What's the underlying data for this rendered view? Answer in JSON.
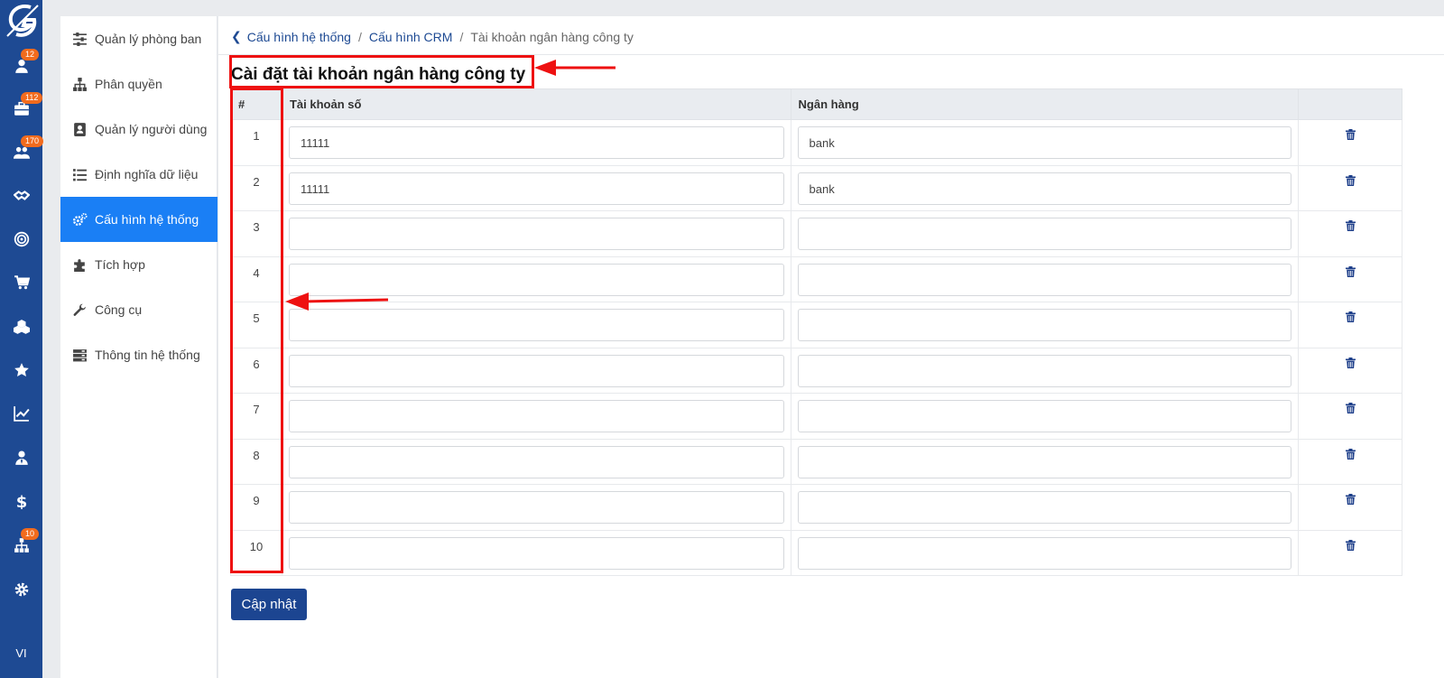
{
  "rail": {
    "items": [
      {
        "icon": "user-icon",
        "badge": "12"
      },
      {
        "icon": "briefcase-icon",
        "badge": "112"
      },
      {
        "icon": "users-icon",
        "badge": "170"
      },
      {
        "icon": "handshake-icon",
        "badge": ""
      },
      {
        "icon": "target-icon",
        "badge": ""
      },
      {
        "icon": "cart-icon",
        "badge": ""
      },
      {
        "icon": "boxes-icon",
        "badge": ""
      },
      {
        "icon": "star-icon",
        "badge": ""
      },
      {
        "icon": "chart-line-icon",
        "badge": ""
      },
      {
        "icon": "user-tie-icon",
        "badge": ""
      },
      {
        "icon": "dollar-icon",
        "badge": ""
      },
      {
        "icon": "sitemap-icon",
        "badge": "10"
      },
      {
        "icon": "gear-icon",
        "badge": ""
      }
    ],
    "lang": "VI"
  },
  "sidebar": {
    "items": [
      {
        "label": "Quản lý phòng ban",
        "icon": "sliders-icon"
      },
      {
        "label": "Phân quyền",
        "icon": "sitemap-icon"
      },
      {
        "label": "Quản lý người dùng",
        "icon": "address-book-icon"
      },
      {
        "label": "Định nghĩa dữ liệu",
        "icon": "list-icon"
      },
      {
        "label": "Cấu hình hệ thống",
        "icon": "gears-icon",
        "active": true
      },
      {
        "label": "Tích hợp",
        "icon": "puzzle-icon"
      },
      {
        "label": "Công cụ",
        "icon": "wrench-icon"
      },
      {
        "label": "Thông tin hệ thống",
        "icon": "server-icon"
      }
    ]
  },
  "breadcrumb": {
    "items": [
      "Cấu hình hệ thống",
      "Cấu hình CRM"
    ],
    "current": "Tài khoản ngân hàng công ty",
    "separator": "/"
  },
  "page": {
    "title": "Cài đặt tài khoản ngân hàng công ty"
  },
  "table": {
    "headers": [
      "#",
      "Tài khoản số",
      "Ngân hàng"
    ],
    "rows": [
      {
        "index": "1",
        "account": "11111",
        "bank": "bank"
      },
      {
        "index": "2",
        "account": "11111",
        "bank": "bank"
      },
      {
        "index": "3",
        "account": "",
        "bank": ""
      },
      {
        "index": "4",
        "account": "",
        "bank": ""
      },
      {
        "index": "5",
        "account": "",
        "bank": ""
      },
      {
        "index": "6",
        "account": "",
        "bank": ""
      },
      {
        "index": "7",
        "account": "",
        "bank": ""
      },
      {
        "index": "8",
        "account": "",
        "bank": ""
      },
      {
        "index": "9",
        "account": "",
        "bank": ""
      },
      {
        "index": "10",
        "account": "",
        "bank": ""
      }
    ]
  },
  "actions": {
    "update_label": "Cập nhật"
  },
  "colors": {
    "rail": "#1e4a93",
    "active": "#1a7ff5",
    "button": "#1c4591",
    "badge": "#f26b1d",
    "annotation": "#ee1111"
  }
}
